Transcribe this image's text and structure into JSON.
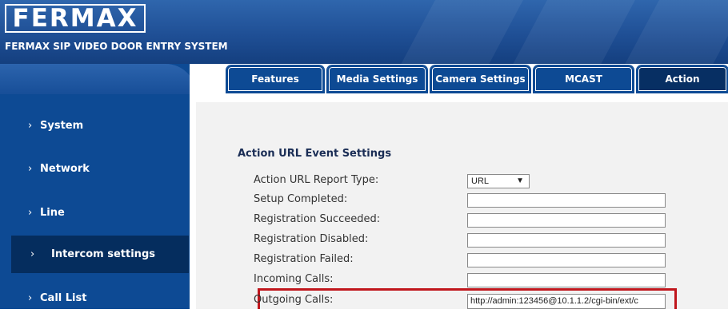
{
  "header": {
    "logo": "FERMAX",
    "subtitle": "FERMAX SIP VIDEO DOOR ENTRY SYSTEM"
  },
  "sidebar": {
    "items": [
      {
        "label": "System"
      },
      {
        "label": "Network"
      },
      {
        "label": "Line"
      },
      {
        "label": "Intercom settings"
      },
      {
        "label": "Call List"
      }
    ],
    "chevron": "›"
  },
  "tabs": [
    {
      "label": "Features"
    },
    {
      "label": "Media Settings"
    },
    {
      "label": "Camera Settings"
    },
    {
      "label": "MCAST"
    },
    {
      "label": "Action"
    }
  ],
  "section": {
    "title": "Action URL Event Settings",
    "report_type_label": "Action URL Report Type:",
    "report_type_value": "URL",
    "rows": [
      {
        "label": "Setup Completed:",
        "value": ""
      },
      {
        "label": "Registration Succeeded:",
        "value": ""
      },
      {
        "label": "Registration Disabled:",
        "value": ""
      },
      {
        "label": "Registration Failed:",
        "value": ""
      },
      {
        "label": "Incoming Calls:",
        "value": ""
      },
      {
        "label": "Outgoing Calls:",
        "value": "http://admin:123456@10.1.1.2/cgi-bin/ext/c"
      }
    ]
  },
  "colors": {
    "header_blue": "#1f4f95",
    "sidebar_blue": "#0d4a94",
    "active_nav": "#052d5e",
    "highlight_red": "#c0161c",
    "panel_gray": "#f2f2f2"
  }
}
